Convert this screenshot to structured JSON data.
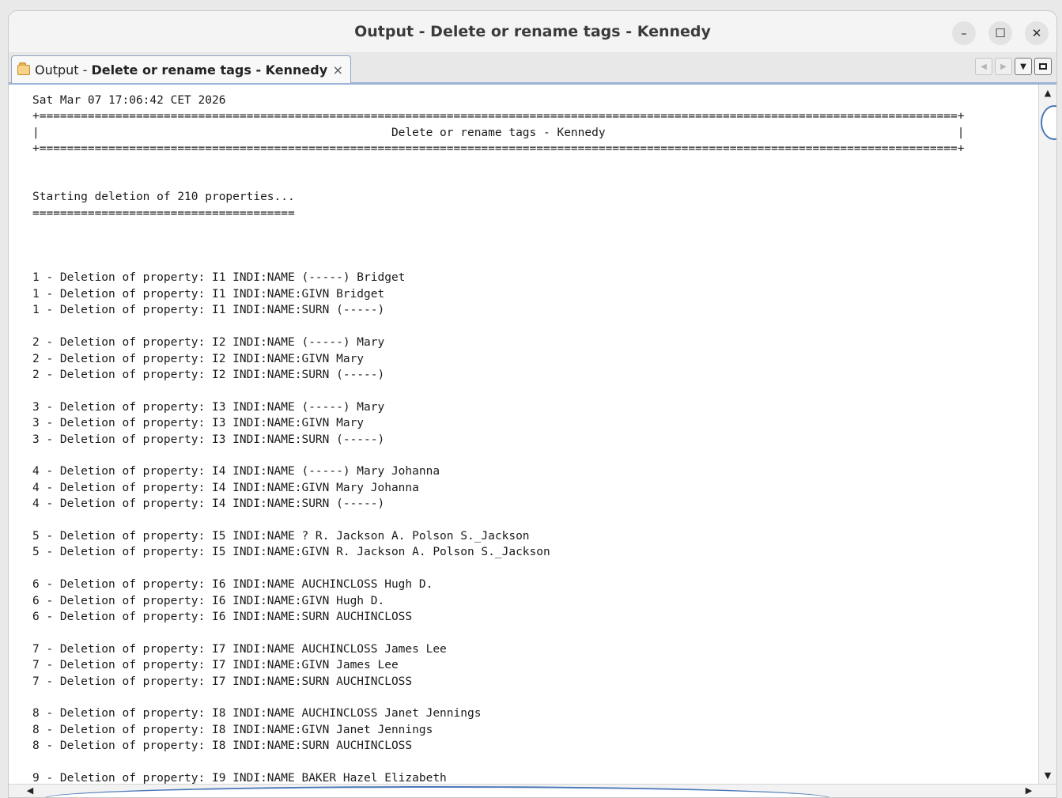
{
  "window": {
    "title": "Output - Delete or rename tags - Kennedy",
    "controls": {
      "minimize": "–",
      "maximize": "☐",
      "close": "✕"
    }
  },
  "tab": {
    "prefix": "Output -",
    "name": "Delete or rename tags - Kennedy",
    "close": "×",
    "icon": "folder-icon"
  },
  "tabnav": {
    "prev": "◀",
    "next": "▶",
    "dropdown": "▼",
    "restore_icon": "restore-window-icon"
  },
  "output": {
    "lines": [
      "Sat Mar 07 17:06:42 CET 2026",
      "+=====================================================================================================================================+",
      "|                                                   Delete or rename tags - Kennedy                                                   |",
      "+=====================================================================================================================================+",
      "",
      "",
      "Starting deletion of 210 properties...",
      "======================================",
      "",
      "",
      "",
      "1 - Deletion of property: I1 INDI:NAME (-----) Bridget",
      "1 - Deletion of property: I1 INDI:NAME:GIVN Bridget",
      "1 - Deletion of property: I1 INDI:NAME:SURN (-----)",
      "",
      "2 - Deletion of property: I2 INDI:NAME (-----) Mary",
      "2 - Deletion of property: I2 INDI:NAME:GIVN Mary",
      "2 - Deletion of property: I2 INDI:NAME:SURN (-----)",
      "",
      "3 - Deletion of property: I3 INDI:NAME (-----) Mary",
      "3 - Deletion of property: I3 INDI:NAME:GIVN Mary",
      "3 - Deletion of property: I3 INDI:NAME:SURN (-----)",
      "",
      "4 - Deletion of property: I4 INDI:NAME (-----) Mary Johanna",
      "4 - Deletion of property: I4 INDI:NAME:GIVN Mary Johanna",
      "4 - Deletion of property: I4 INDI:NAME:SURN (-----)",
      "",
      "5 - Deletion of property: I5 INDI:NAME ? R. Jackson A. Polson S._Jackson",
      "5 - Deletion of property: I5 INDI:NAME:GIVN R. Jackson A. Polson S._Jackson",
      "",
      "6 - Deletion of property: I6 INDI:NAME AUCHINCLOSS Hugh D.",
      "6 - Deletion of property: I6 INDI:NAME:GIVN Hugh D.",
      "6 - Deletion of property: I6 INDI:NAME:SURN AUCHINCLOSS",
      "",
      "7 - Deletion of property: I7 INDI:NAME AUCHINCLOSS James Lee",
      "7 - Deletion of property: I7 INDI:NAME:GIVN James Lee",
      "7 - Deletion of property: I7 INDI:NAME:SURN AUCHINCLOSS",
      "",
      "8 - Deletion of property: I8 INDI:NAME AUCHINCLOSS Janet Jennings",
      "8 - Deletion of property: I8 INDI:NAME:GIVN Janet Jennings",
      "8 - Deletion of property: I8 INDI:NAME:SURN AUCHINCLOSS",
      "",
      "9 - Deletion of property: I9 INDI:NAME BAKER Hazel Elizabeth"
    ]
  }
}
